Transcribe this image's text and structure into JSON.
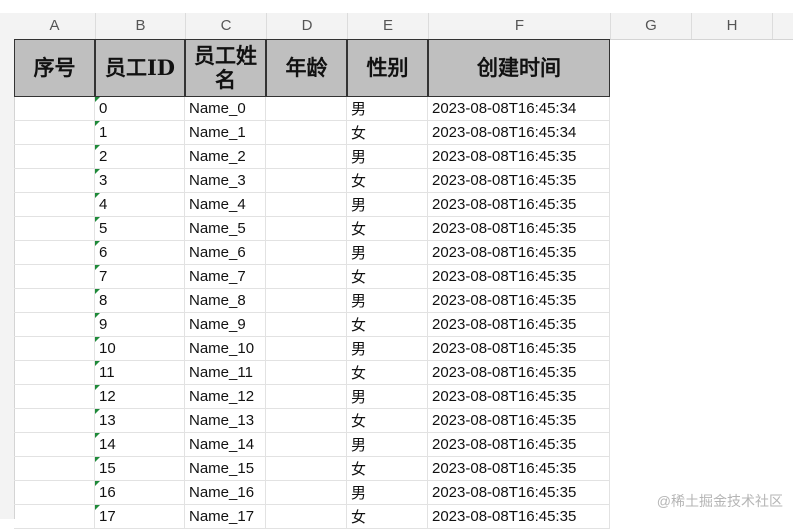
{
  "columns": [
    "A",
    "B",
    "C",
    "D",
    "E",
    "F",
    "G",
    "H"
  ],
  "header": [
    "序号",
    "员工ID",
    "员工姓名",
    "年龄",
    "性别",
    "创建时间"
  ],
  "rows": [
    {
      "id": "0",
      "name": "Name_0",
      "gender": "男",
      "created": "2023-08-08T16:45:34"
    },
    {
      "id": "1",
      "name": "Name_1",
      "gender": "女",
      "created": "2023-08-08T16:45:34"
    },
    {
      "id": "2",
      "name": "Name_2",
      "gender": "男",
      "created": "2023-08-08T16:45:35"
    },
    {
      "id": "3",
      "name": "Name_3",
      "gender": "女",
      "created": "2023-08-08T16:45:35"
    },
    {
      "id": "4",
      "name": "Name_4",
      "gender": "男",
      "created": "2023-08-08T16:45:35"
    },
    {
      "id": "5",
      "name": "Name_5",
      "gender": "女",
      "created": "2023-08-08T16:45:35"
    },
    {
      "id": "6",
      "name": "Name_6",
      "gender": "男",
      "created": "2023-08-08T16:45:35"
    },
    {
      "id": "7",
      "name": "Name_7",
      "gender": "女",
      "created": "2023-08-08T16:45:35"
    },
    {
      "id": "8",
      "name": "Name_8",
      "gender": "男",
      "created": "2023-08-08T16:45:35"
    },
    {
      "id": "9",
      "name": "Name_9",
      "gender": "女",
      "created": "2023-08-08T16:45:35"
    },
    {
      "id": "10",
      "name": "Name_10",
      "gender": "男",
      "created": "2023-08-08T16:45:35"
    },
    {
      "id": "11",
      "name": "Name_11",
      "gender": "女",
      "created": "2023-08-08T16:45:35"
    },
    {
      "id": "12",
      "name": "Name_12",
      "gender": "男",
      "created": "2023-08-08T16:45:35"
    },
    {
      "id": "13",
      "name": "Name_13",
      "gender": "女",
      "created": "2023-08-08T16:45:35"
    },
    {
      "id": "14",
      "name": "Name_14",
      "gender": "男",
      "created": "2023-08-08T16:45:35"
    },
    {
      "id": "15",
      "name": "Name_15",
      "gender": "女",
      "created": "2023-08-08T16:45:35"
    },
    {
      "id": "16",
      "name": "Name_16",
      "gender": "男",
      "created": "2023-08-08T16:45:35"
    },
    {
      "id": "17",
      "name": "Name_17",
      "gender": "女",
      "created": "2023-08-08T16:45:35"
    }
  ],
  "watermark": "@稀土掘金技术社区",
  "colors": {
    "header_fill": "#bfbfbf",
    "header_border": "#333333",
    "number_stored_as_text_marker": "#1f8a3a",
    "row_number_text": "#2f6fb5"
  }
}
